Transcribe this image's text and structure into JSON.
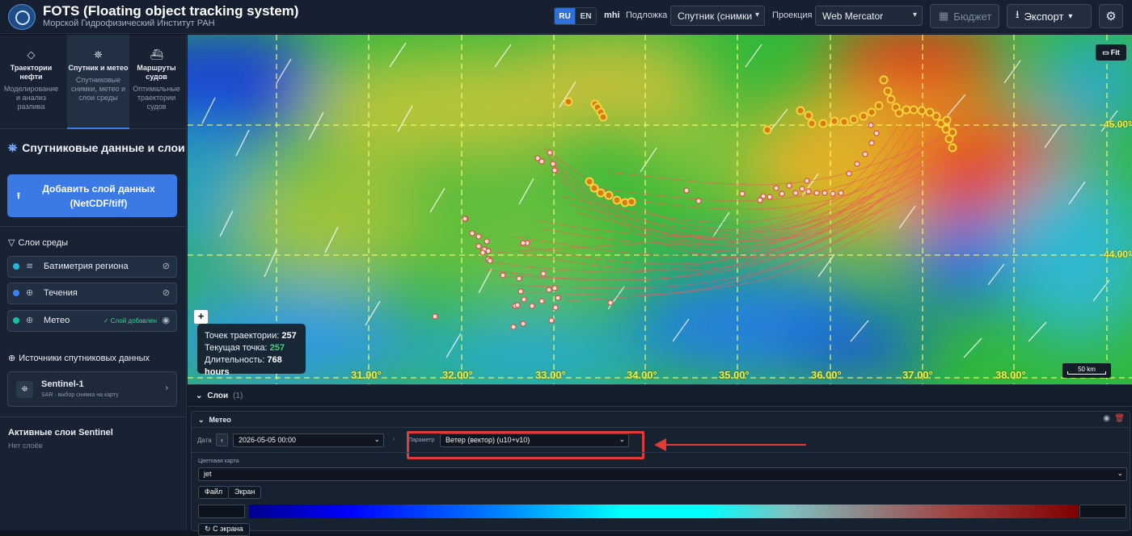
{
  "header": {
    "title": "FOTS (Floating object tracking system)",
    "subtitle": "Морской Гидрофизический Институт РАН",
    "lang_ru": "RU",
    "lang_en": "EN",
    "mhi": "mhi",
    "basemap_label": "Подложка",
    "basemap_value": "Спутник (снимки",
    "projection_label": "Проекция",
    "projection_value": "Web Mercator",
    "budget_label": "Бюджет",
    "export_label": "Экспорт"
  },
  "tabs": [
    {
      "title": "Траектории нефти",
      "desc": "Моделирование и анализ разлива"
    },
    {
      "title": "Спутник и метео",
      "desc": "Спутниковые снимки, метео и слои среды"
    },
    {
      "title": "Маршруты судов",
      "desc": "Оптимальные траектории судов"
    }
  ],
  "sidebar": {
    "section_title": "Спутниковые данные и слои",
    "add_layer_label": "Добавить слой данных (NetCDF/tiff)",
    "env_layers_title": "Слои среды",
    "layers": [
      {
        "name": "Батиметрия региона",
        "dot": "#20b8d8"
      },
      {
        "name": "Течения",
        "dot": "#3b82f6"
      },
      {
        "name": "Метео",
        "dot": "#16c0a0",
        "status": "Слой добавлен"
      }
    ],
    "sources_title": "Источники спутниковых данных",
    "source_name": "Sentinel-1",
    "source_sub": "SAR · выбор снимка на карту",
    "active_title": "Активные слои Sentinel",
    "active_empty": "Нет слоёв"
  },
  "map": {
    "fit_label": "Fit",
    "info_points_label": "Точек траектории:",
    "info_points_value": "257",
    "info_current_label": "Текущая точка:",
    "info_current_value": "257",
    "info_duration_label": "Длительность:",
    "info_duration_value": "768 hours",
    "lat_labels": [
      "45.00°",
      "44.00°"
    ],
    "lon_labels": [
      "31.00°",
      "32.00°",
      "33.00°",
      "34.00°",
      "35.00°",
      "36.00°",
      "37.00°",
      "38.00°"
    ],
    "scale_label": "50 km"
  },
  "bottom": {
    "layers_title": "Слои",
    "layers_count": "(1)",
    "layer_name": "Метео",
    "date_label": "Дата",
    "date_value": "2026-05-05 00:00",
    "param_label": "Параметр",
    "param_value": "Ветер (вектор) (u10+v10)",
    "colormap_label": "Цветовая карта",
    "colormap_value": "jet",
    "file_btn": "Файл",
    "screen_btn": "Экран",
    "from_screen_btn": "С экрана"
  }
}
